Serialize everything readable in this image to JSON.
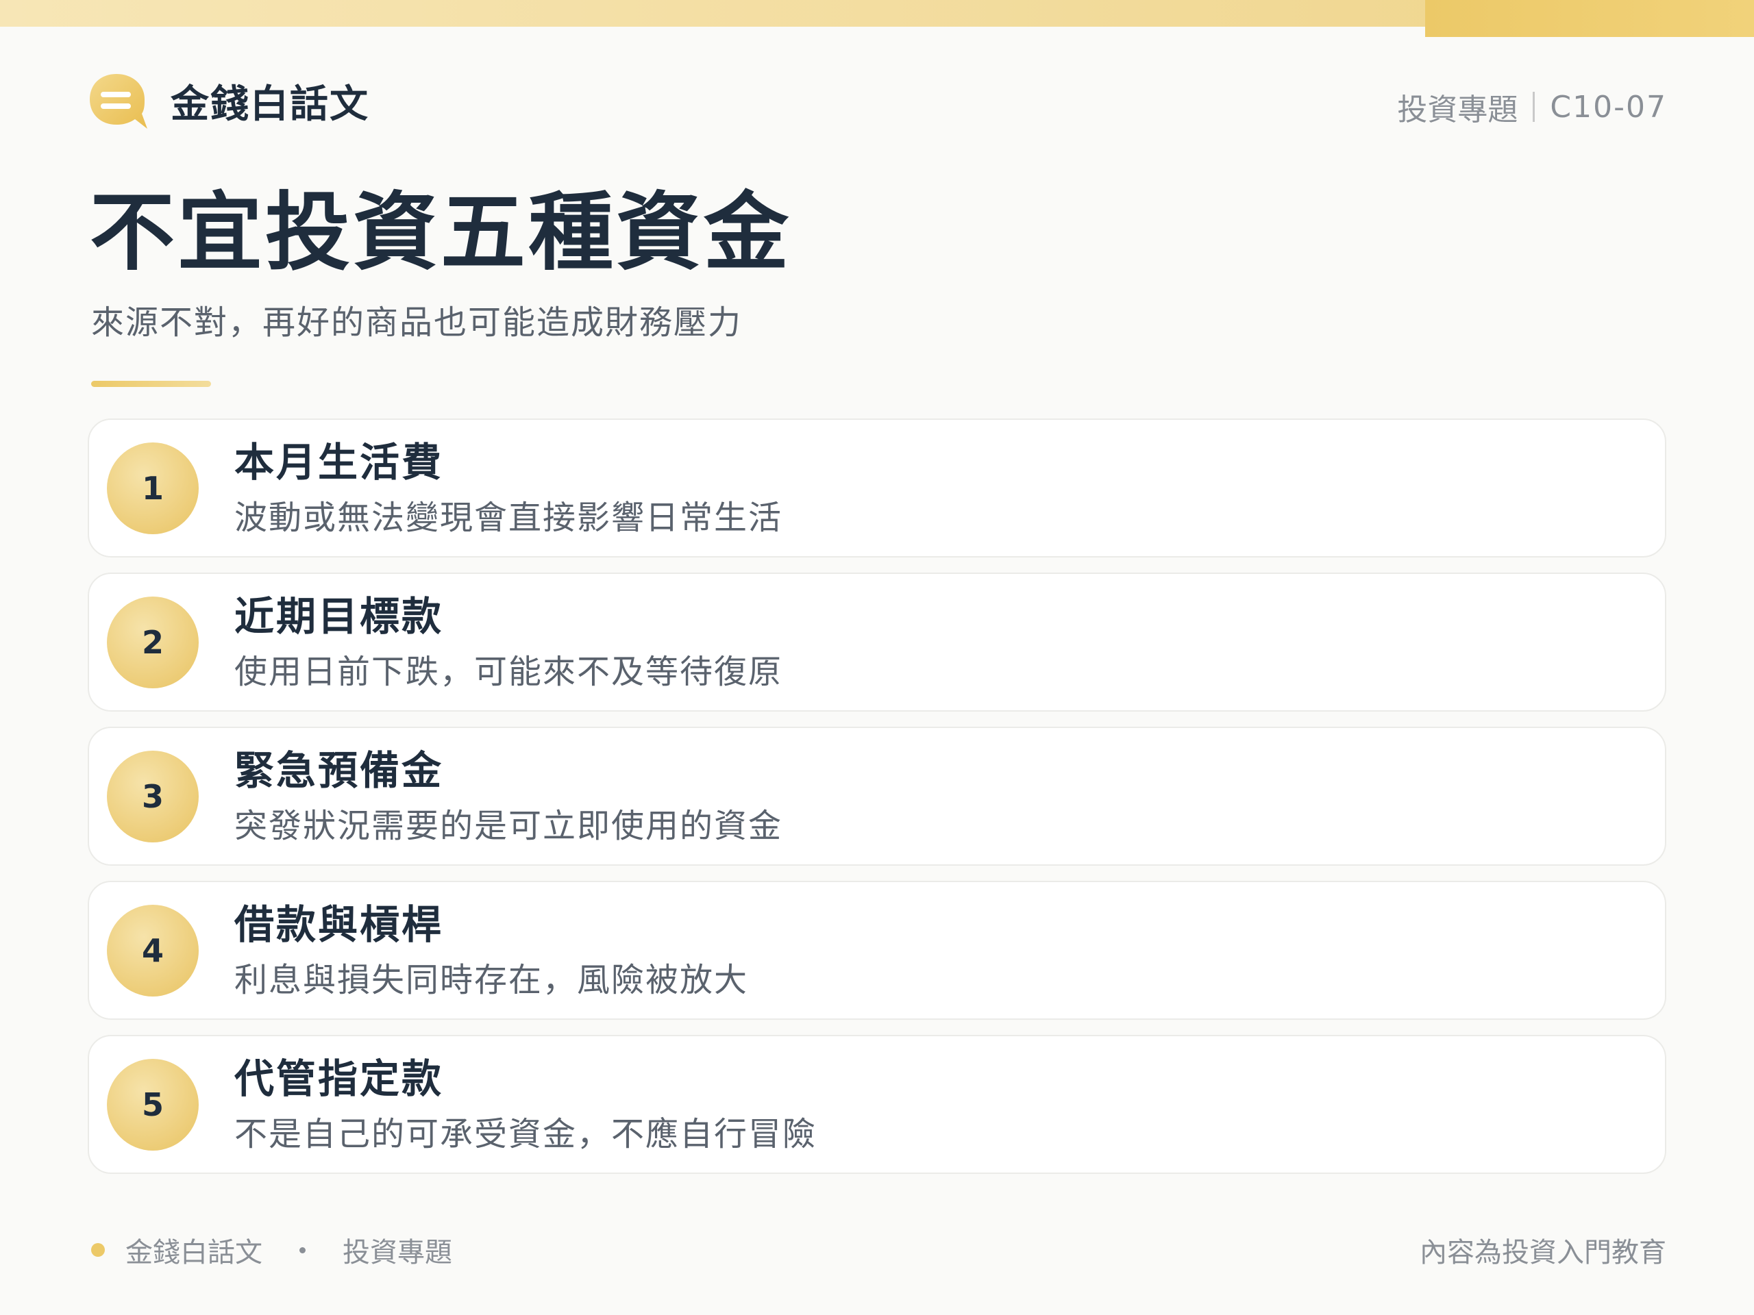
{
  "header": {
    "brand_name": "金錢白話文",
    "topic_label": "投資專題",
    "topic_code": "C10-07"
  },
  "main": {
    "title": "不宜投資五種資金",
    "subtitle": "來源不對，再好的商品也可能造成財務壓力",
    "items": [
      {
        "number": "1",
        "title": "本月生活費",
        "desc": "波動或無法變現會直接影響日常生活"
      },
      {
        "number": "2",
        "title": "近期目標款",
        "desc": "使用日前下跌，可能來不及等待復原"
      },
      {
        "number": "3",
        "title": "緊急預備金",
        "desc": "突發狀況需要的是可立即使用的資金"
      },
      {
        "number": "4",
        "title": "借款與槓桿",
        "desc": "利息與損失同時存在，風險被放大"
      },
      {
        "number": "5",
        "title": "代管指定款",
        "desc": "不是自己的可承受資金，不應自行冒險"
      }
    ]
  },
  "footer": {
    "brand": "金錢白話文",
    "topic": "投資專題",
    "note": "內容為投資入門教育"
  },
  "colors": {
    "accent": "#ecc968",
    "text_dark": "#1f2d3d",
    "text_muted": "#5a626d",
    "background": "#fafaf8"
  },
  "icons": {
    "brand": "chat-bubble-icon"
  }
}
